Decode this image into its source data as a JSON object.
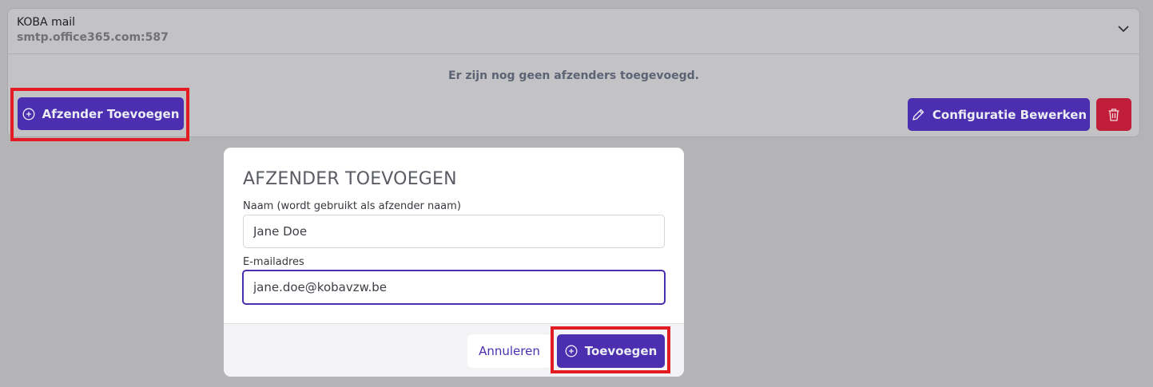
{
  "config_card": {
    "title": "KOBA mail",
    "server": "smtp.office365.com:587",
    "empty_message": "Er zijn nog geen afzenders toegevoegd.",
    "add_sender_label": "Afzender Toevoegen",
    "edit_config_label": "Configuratie Bewerken"
  },
  "modal": {
    "title": "AFZENDER TOEVOEGEN",
    "name_label": "Naam (wordt gebruikt als afzender naam)",
    "name_value": "Jane Doe",
    "email_label": "E-mailadres",
    "email_value": "jane.doe@kobavzw.be",
    "cancel_label": "Annuleren",
    "submit_label": "Toevoegen"
  },
  "colors": {
    "primary": "#4b2fb0",
    "danger": "#bf1d3a",
    "highlight": "#e31b23"
  }
}
